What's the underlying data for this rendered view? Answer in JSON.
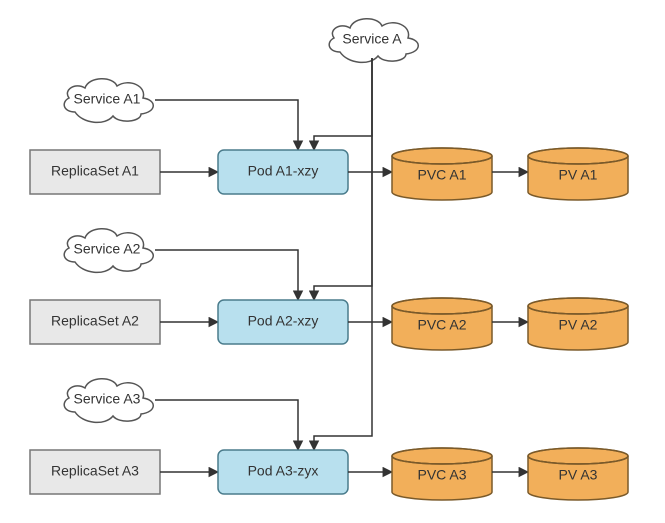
{
  "serviceTop": "Service A",
  "rows": [
    {
      "service": "Service A1",
      "replicaset": "ReplicaSet A1",
      "pod": "Pod A1-xzy",
      "pvc": "PVC A1",
      "pv": "PV A1"
    },
    {
      "service": "Service A2",
      "replicaset": "ReplicaSet A2",
      "pod": "Pod A2-xzy",
      "pvc": "PVC A2",
      "pv": "PV A2"
    },
    {
      "service": "Service A3",
      "replicaset": "ReplicaSet A3",
      "pod": "Pod A3-zyx",
      "pvc": "PVC A3",
      "pv": "PV A3"
    }
  ]
}
